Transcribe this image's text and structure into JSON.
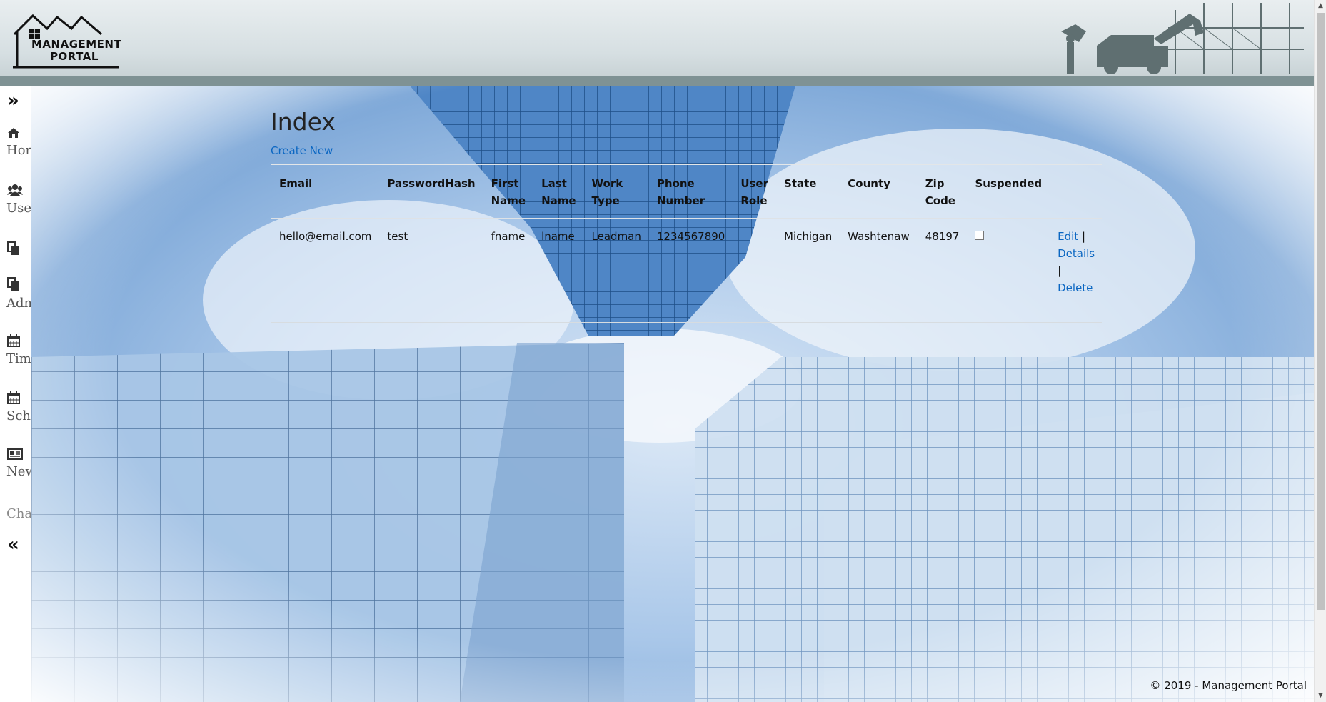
{
  "header": {
    "logo_text_line1": "MANAGEMENT",
    "logo_text_line2": "PORTAL"
  },
  "sidebar": {
    "expand_icon": "double-chevron-right",
    "collapse_icon": "double-chevron-left",
    "items": [
      {
        "icon": "home-icon",
        "label": "Home"
      },
      {
        "icon": "users-icon",
        "label": "Users"
      },
      {
        "icon": "copy-icon",
        "label": ""
      },
      {
        "icon": "copy-icon",
        "label": "Admin"
      },
      {
        "icon": "calendar-icon",
        "label": "Time"
      },
      {
        "icon": "calendar-icon",
        "label": "Schedule"
      },
      {
        "icon": "newspaper-icon",
        "label": "News"
      },
      {
        "icon": "",
        "label": "Chat"
      }
    ]
  },
  "main": {
    "title": "Index",
    "create_link": "Create New",
    "columns": [
      "Email",
      "PasswordHash",
      "First Name",
      "Last Name",
      "Work Type",
      "Phone Number",
      "User Role",
      "State",
      "County",
      "Zip Code",
      "Suspended",
      ""
    ],
    "rows": [
      {
        "email": "hello@email.com",
        "password_hash": "test",
        "first_name": "fname",
        "last_name": "lname",
        "work_type": "Leadman",
        "phone": "1234567890",
        "user_role": "",
        "state": "Michigan",
        "county": "Washtenaw",
        "zip": "48197",
        "suspended": false,
        "actions": {
          "edit": "Edit",
          "details": "Details",
          "delete": "Delete",
          "separator": "|"
        }
      }
    ]
  },
  "footer": {
    "text": "© 2019 - Management Portal"
  },
  "colors": {
    "link": "#0a66c2",
    "header_bar": "#7f9294"
  }
}
